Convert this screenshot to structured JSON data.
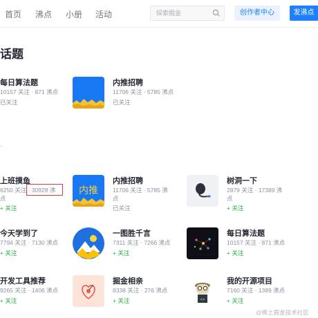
{
  "nav": {
    "items": [
      "首页",
      "沸点",
      "小册",
      "活动"
    ],
    "search_placeholder": "探索掘金",
    "creator_center": "创作者中心",
    "post_button": "发沸点"
  },
  "page": {
    "title": "话题"
  },
  "topics": [
    {
      "name": "每日算法题",
      "stats": "10157 关注 · 871 沸点",
      "status": "已关注"
    },
    {
      "name": "内推招聘",
      "stats": "11706 关注 · 5785 沸点",
      "status": "已关注"
    },
    {
      "name": "上班摸鱼",
      "stats": "6250 关注 · 30928 沸",
      "stats2": "点",
      "status": "+ 关注"
    },
    {
      "name": "内推招聘",
      "stats": "11706 关注 · 5785 沸",
      "stats2": "点",
      "status": "已关注"
    },
    {
      "name": "树洞一下",
      "stats": "2879 关注 · 17389 沸",
      "stats2": "点",
      "status": "+ 关注"
    },
    {
      "name": "今天学到了",
      "stats": "7794 关注 · 7130 沸点",
      "status": "+ 关注"
    },
    {
      "name": "一图胜千言",
      "stats": "7311 关注 · 7266 沸点",
      "status": "+ 关注"
    },
    {
      "name": "每日算法题",
      "stats": "10157 关注 · 871 沸点",
      "status": "+ 关注"
    },
    {
      "name": "开发工具推荐",
      "stats": "9265 关注 · 1406 沸点",
      "status": "+ 关注"
    },
    {
      "name": "掘金相亲",
      "stats": "8338 关注 · 276 沸点",
      "status": "+ 关注"
    },
    {
      "name": "我的开源项目",
      "stats": "7160 关注 · 1389 沸点",
      "status": "+ 关注"
    }
  ],
  "thumb_text": {
    "neitui": "内推"
  },
  "watermark": "@稀土掘金技术社区",
  "colors": {
    "brand_blue": "#1e80ff",
    "follow_green": "#1fae3e",
    "highlight_red": "#e23a3a"
  }
}
